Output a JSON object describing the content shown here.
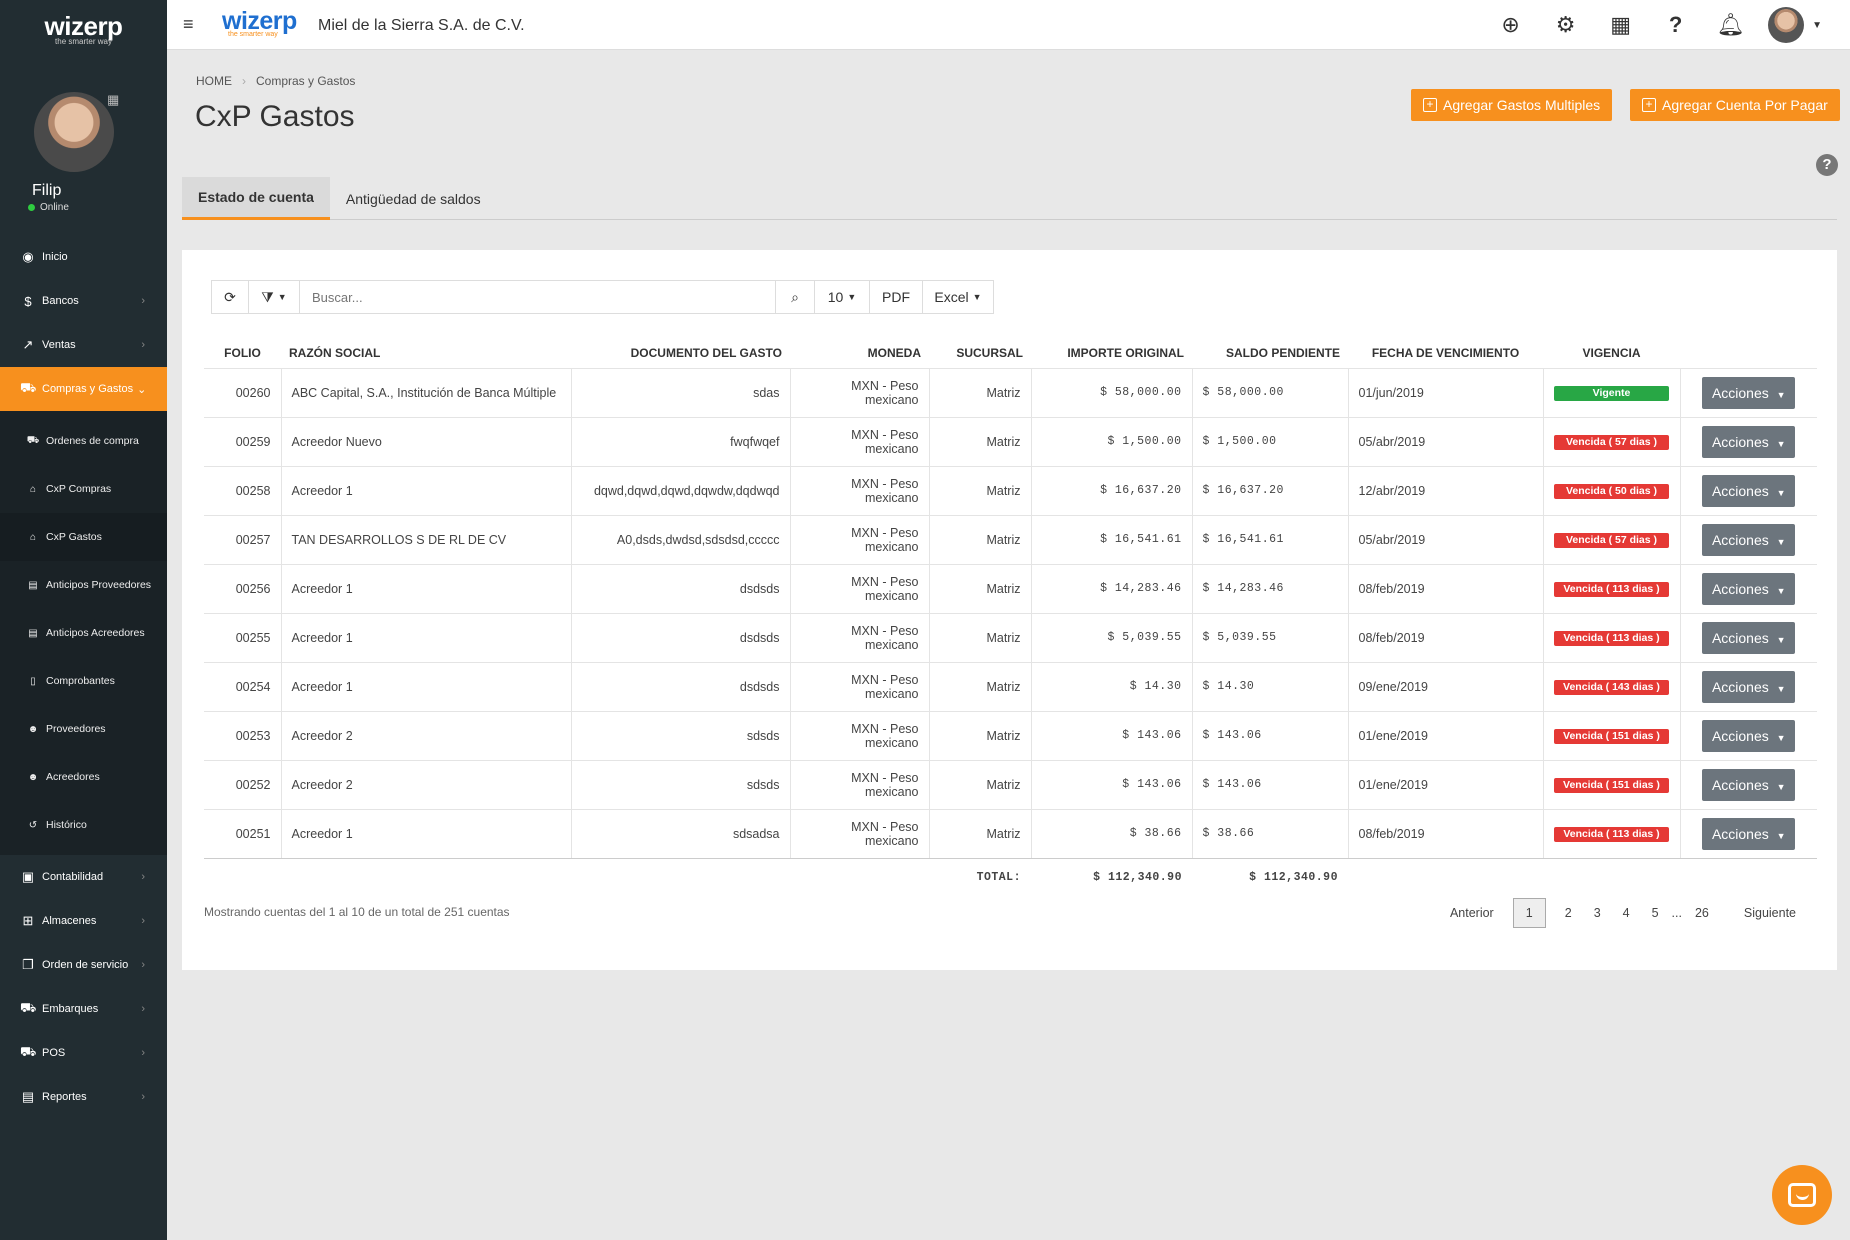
{
  "brand": {
    "name": "wizerp",
    "tagline": "the smarter way"
  },
  "user": {
    "name": "Filip",
    "status": "Online"
  },
  "sidebar": {
    "items": [
      {
        "label": "Inicio",
        "icon": "dashboard-icon",
        "glyph": "◉"
      },
      {
        "label": "Bancos",
        "icon": "dollar-icon",
        "glyph": "$"
      },
      {
        "label": "Ventas",
        "icon": "chart-line-icon",
        "glyph": "↗"
      },
      {
        "label": "Compras y Gastos",
        "icon": "cart-icon",
        "glyph": "⛟"
      }
    ],
    "subitems": [
      {
        "label": "Ordenes de compra",
        "icon": "cart-icon",
        "glyph": "⛟"
      },
      {
        "label": "CxP Compras",
        "icon": "bank-icon",
        "glyph": "⌂"
      },
      {
        "label": "CxP Gastos",
        "icon": "bank-icon",
        "glyph": "⌂"
      },
      {
        "label": "Anticipos Proveedores",
        "icon": "list-icon",
        "glyph": "▤"
      },
      {
        "label": "Anticipos Acreedores",
        "icon": "list-icon",
        "glyph": "▤"
      },
      {
        "label": "Comprobantes",
        "icon": "file-icon",
        "glyph": "▯"
      },
      {
        "label": "Proveedores",
        "icon": "users-icon",
        "glyph": "☻"
      },
      {
        "label": "Acreedores",
        "icon": "users-icon",
        "glyph": "☻"
      },
      {
        "label": "Histórico",
        "icon": "history-icon",
        "glyph": "↺"
      }
    ],
    "items2": [
      {
        "label": "Contabilidad",
        "icon": "money-icon",
        "glyph": "▣"
      },
      {
        "label": "Almacenes",
        "icon": "warehouse-icon",
        "glyph": "⊞"
      },
      {
        "label": "Orden de servicio",
        "icon": "copy-icon",
        "glyph": "❐"
      },
      {
        "label": "Embarques",
        "icon": "truck-icon",
        "glyph": "⛟"
      },
      {
        "label": "POS",
        "icon": "cart-icon",
        "glyph": "⛟"
      },
      {
        "label": "Reportes",
        "icon": "list-alt-icon",
        "glyph": "▤"
      }
    ]
  },
  "topbar": {
    "company": "Miel de la Sierra S.A. de C.V."
  },
  "breadcrumb": {
    "home": "HOME",
    "section": "Compras y Gastos"
  },
  "page": {
    "title": "CxP Gastos"
  },
  "actions": {
    "add_multiple": "Agregar Gastos Multiples",
    "add_account": "Agregar Cuenta Por Pagar"
  },
  "tabs": [
    {
      "label": "Estado de cuenta"
    },
    {
      "label": "Antigüedad de saldos"
    }
  ],
  "toolbar": {
    "search_placeholder": "Buscar...",
    "page_size": "10",
    "pdf": "PDF",
    "excel": "Excel"
  },
  "table": {
    "headers": [
      "FOLIO",
      "RAZÓN SOCIAL",
      "DOCUMENTO DEL GASTO",
      "MONEDA",
      "SUCURSAL",
      "IMPORTE ORIGINAL",
      "SALDO PENDIENTE",
      "FECHA DE VENCIMIENTO",
      "VIGENCIA"
    ],
    "action_label": "Acciones",
    "rows": [
      {
        "folio": "00260",
        "razon": "ABC Capital, S.A., Institución de Banca Múltiple",
        "doc": "sdas",
        "moneda": "MXN - Peso mexicano",
        "sucursal": "Matriz",
        "importe": "$ 58,000.00",
        "saldo": "$ 58,000.00",
        "fecha": "01/jun/2019",
        "vigencia": "Vigente",
        "status": "ok"
      },
      {
        "folio": "00259",
        "razon": "Acreedor Nuevo",
        "doc": "fwqfwqef",
        "moneda": "MXN - Peso mexicano",
        "sucursal": "Matriz",
        "importe": "$ 1,500.00",
        "saldo": "$ 1,500.00",
        "fecha": "05/abr/2019",
        "vigencia": "Vencida ( 57 dias )",
        "status": "bad"
      },
      {
        "folio": "00258",
        "razon": "Acreedor 1",
        "doc": "dqwd,dqwd,dqwd,dqwdw,dqdwqd",
        "moneda": "MXN - Peso mexicano",
        "sucursal": "Matriz",
        "importe": "$ 16,637.20",
        "saldo": "$ 16,637.20",
        "fecha": "12/abr/2019",
        "vigencia": "Vencida ( 50 dias )",
        "status": "bad"
      },
      {
        "folio": "00257",
        "razon": "TAN DESARROLLOS S DE RL DE CV",
        "doc": "A0,dsds,dwdsd,sdsdsd,ccccc",
        "moneda": "MXN - Peso mexicano",
        "sucursal": "Matriz",
        "importe": "$ 16,541.61",
        "saldo": "$ 16,541.61",
        "fecha": "05/abr/2019",
        "vigencia": "Vencida ( 57 dias )",
        "status": "bad"
      },
      {
        "folio": "00256",
        "razon": "Acreedor 1",
        "doc": "dsdsds",
        "moneda": "MXN - Peso mexicano",
        "sucursal": "Matriz",
        "importe": "$ 14,283.46",
        "saldo": "$ 14,283.46",
        "fecha": "08/feb/2019",
        "vigencia": "Vencida ( 113 dias )",
        "status": "bad"
      },
      {
        "folio": "00255",
        "razon": "Acreedor 1",
        "doc": "dsdsds",
        "moneda": "MXN - Peso mexicano",
        "sucursal": "Matriz",
        "importe": "$ 5,039.55",
        "saldo": "$ 5,039.55",
        "fecha": "08/feb/2019",
        "vigencia": "Vencida ( 113 dias )",
        "status": "bad"
      },
      {
        "folio": "00254",
        "razon": "Acreedor 1",
        "doc": "dsdsds",
        "moneda": "MXN - Peso mexicano",
        "sucursal": "Matriz",
        "importe": "$ 14.30",
        "saldo": "$ 14.30",
        "fecha": "09/ene/2019",
        "vigencia": "Vencida ( 143 dias )",
        "status": "bad"
      },
      {
        "folio": "00253",
        "razon": "Acreedor 2",
        "doc": "sdsds",
        "moneda": "MXN - Peso mexicano",
        "sucursal": "Matriz",
        "importe": "$ 143.06",
        "saldo": "$ 143.06",
        "fecha": "01/ene/2019",
        "vigencia": "Vencida ( 151 dias )",
        "status": "bad"
      },
      {
        "folio": "00252",
        "razon": "Acreedor 2",
        "doc": "sdsds",
        "moneda": "MXN - Peso mexicano",
        "sucursal": "Matriz",
        "importe": "$ 143.06",
        "saldo": "$ 143.06",
        "fecha": "01/ene/2019",
        "vigencia": "Vencida ( 151 dias )",
        "status": "bad"
      },
      {
        "folio": "00251",
        "razon": "Acreedor 1",
        "doc": "sdsadsa",
        "moneda": "MXN - Peso mexicano",
        "sucursal": "Matriz",
        "importe": "$ 38.66",
        "saldo": "$ 38.66",
        "fecha": "08/feb/2019",
        "vigencia": "Vencida ( 113 dias )",
        "status": "bad"
      }
    ],
    "total_label": "TOTAL:",
    "total_importe": "$ 112,340.90",
    "total_saldo": "$ 112,340.90"
  },
  "footer": {
    "info": "Mostrando cuentas del 1 al 10 de un total de 251 cuentas"
  },
  "pagination": {
    "prev": "Anterior",
    "pages": [
      "1",
      "2",
      "3",
      "4",
      "5"
    ],
    "ellipsis": "...",
    "last": "26",
    "next": "Siguiente",
    "current": "1"
  },
  "colors": {
    "accent": "#f7901e",
    "sidebar": "#222d32",
    "success": "#28a745",
    "danger": "#e53935",
    "action": "#6c757d"
  }
}
